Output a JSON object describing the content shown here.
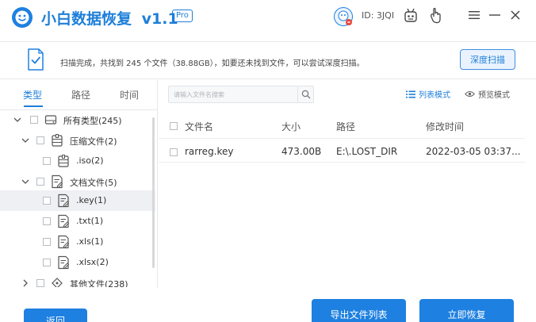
{
  "app": {
    "title": "小白数据恢复",
    "version": "v1.1",
    "badge": "Pro"
  },
  "user": {
    "id_text": "ID: 3JQI"
  },
  "scan": {
    "summary": "扫描完成，共找到 245 个文件（38.88GB），如要还未找到文件，可以尝试深度扫描。",
    "deep_scan_label": "深度扫描"
  },
  "tabs": [
    "类型",
    "路径",
    "时间"
  ],
  "tree": [
    {
      "label": "所有类型(245)",
      "icon": "drive-icon"
    },
    {
      "label": "压缩文件(2)",
      "icon": "archive-icon"
    },
    {
      "label": ".iso(2)",
      "icon": "archive-icon"
    },
    {
      "label": "文档文件(5)",
      "icon": "document-icon"
    },
    {
      "label": ".key(1)",
      "icon": "document-icon"
    },
    {
      "label": ".txt(1)",
      "icon": "document-icon"
    },
    {
      "label": ".xls(1)",
      "icon": "document-icon"
    },
    {
      "label": ".xlsx(2)",
      "icon": "document-icon"
    },
    {
      "label": "其他文件(238)",
      "icon": "other-icon"
    }
  ],
  "search": {
    "placeholder": "请输入文件名搜索"
  },
  "view_modes": {
    "list": "列表模式",
    "preview": "预览模式"
  },
  "table": {
    "headers": [
      "文件名",
      "大小",
      "路径",
      "修改时间"
    ],
    "rows": [
      {
        "name": "rarreg.key",
        "size": "473.00B",
        "path": "E:\\.LOST_DIR",
        "modified": "2022-03-05 03:37..."
      }
    ]
  },
  "buttons": {
    "back": "返回",
    "export": "导出文件列表",
    "recover": "立即恢复"
  },
  "colors": {
    "accent": "#1e80e0",
    "title_blue": "#1e7fd9"
  }
}
